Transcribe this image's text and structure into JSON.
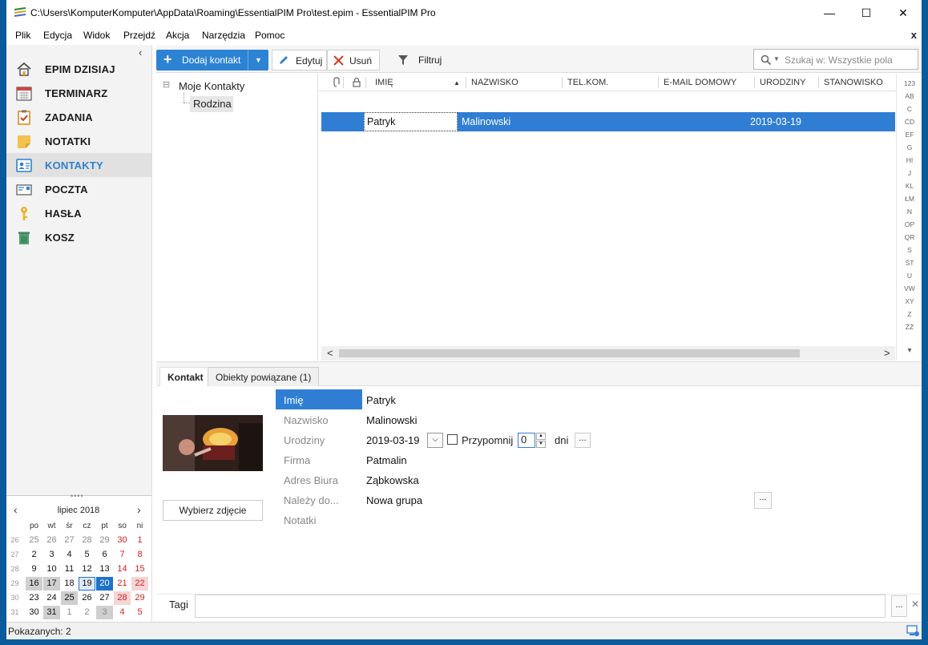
{
  "window": {
    "title": "C:\\Users\\KomputerKomputer\\AppData\\Roaming\\EssentialPIM Pro\\test.epim - EssentialPIM Pro",
    "minimize": "—",
    "maximize": "☐",
    "close": "✕"
  },
  "menu": {
    "items": [
      "Plik",
      "Edycja",
      "Widok",
      "Przejdź",
      "Akcja",
      "Narzędzia",
      "Pomoc"
    ],
    "close": "x"
  },
  "sidebar": {
    "collapse": "‹",
    "items": [
      {
        "label": "EPIM DZISIAJ",
        "icon": "home-icon"
      },
      {
        "label": "TERMINARZ",
        "icon": "calendar-icon"
      },
      {
        "label": "ZADANIA",
        "icon": "tasks-icon"
      },
      {
        "label": "NOTATKI",
        "icon": "notes-icon"
      },
      {
        "label": "KONTAKTY",
        "icon": "contacts-icon"
      },
      {
        "label": "POCZTA",
        "icon": "mail-icon"
      },
      {
        "label": "HASŁA",
        "icon": "key-icon"
      },
      {
        "label": "KOSZ",
        "icon": "trash-icon"
      }
    ],
    "active": 4
  },
  "calendar": {
    "grip": "••••",
    "prev": "‹",
    "next": "›",
    "title": "lipiec  2018",
    "weekdays": [
      "po",
      "wt",
      "śr",
      "cz",
      "pt",
      "so",
      "ni"
    ],
    "weeks": [
      {
        "wk": "26",
        "days": [
          "25",
          "26",
          "27",
          "28",
          "29",
          "30",
          "1"
        ]
      },
      {
        "wk": "27",
        "days": [
          "2",
          "3",
          "4",
          "5",
          "6",
          "7",
          "8"
        ]
      },
      {
        "wk": "28",
        "days": [
          "9",
          "10",
          "11",
          "12",
          "13",
          "14",
          "15"
        ]
      },
      {
        "wk": "29",
        "days": [
          "16",
          "17",
          "18",
          "19",
          "20",
          "21",
          "22"
        ]
      },
      {
        "wk": "30",
        "days": [
          "23",
          "24",
          "25",
          "26",
          "27",
          "28",
          "29"
        ]
      },
      {
        "wk": "31",
        "days": [
          "30",
          "31",
          "1",
          "2",
          "3",
          "4",
          "5"
        ]
      }
    ]
  },
  "toolbar": {
    "add": "Dodaj kontakt",
    "edit": "Edytuj",
    "delete": "Usuń",
    "filter": "Filtruj",
    "search_placeholder": "Szukaj w: Wszystkie pola"
  },
  "tree": {
    "root": "Moje Kontakty",
    "child": "Rodzina",
    "expander": "⊟"
  },
  "grid": {
    "columns": [
      "IMIĘ",
      "NAZWISKO",
      "TEL.KOM.",
      "E-MAIL DOMOWY",
      "URODZINY",
      "STANOWISKO"
    ],
    "sort_marker": "▲",
    "rows": [
      {
        "imie": "Patryk",
        "nazwisko": "Malinowski",
        "urodziny": "2019-03-19"
      }
    ],
    "scroll_left": "<",
    "scroll_right": ">"
  },
  "alpha_index": [
    "123",
    "AB",
    "C",
    "ĆD",
    "EF",
    "G",
    "HI",
    "J",
    "KL",
    "ŁM",
    "N",
    "OP",
    "QR",
    "S",
    "ŚT",
    "U",
    "VW",
    "XY",
    "Z",
    "ŹŻ"
  ],
  "alpha_scroll_down": "▾",
  "detail": {
    "tabs": [
      "Kontakt",
      "Obiekty powiązane  (1)"
    ],
    "fields": [
      {
        "label": "Imię",
        "value": "Patryk"
      },
      {
        "label": "Nazwisko",
        "value": "Malinowski"
      },
      {
        "label": "Urodziny",
        "value": "2019-03-19"
      },
      {
        "label": "Firma",
        "value": "Patmalin"
      },
      {
        "label": "Adres Biura",
        "value": "Ząbkowska"
      },
      {
        "label": "Należy do...",
        "value": "Nowa grupa"
      },
      {
        "label": "Notatki",
        "value": ""
      }
    ],
    "remind_label": "Przypomnij",
    "remind_value": "0",
    "remind_unit": "dni",
    "ellipsis": "...",
    "photo_button": "Wybierz zdjęcie"
  },
  "tags": {
    "label": "Tagi",
    "ellipsis": "...",
    "clear": "✕"
  },
  "status": {
    "text": "Pokazanych: 2"
  }
}
